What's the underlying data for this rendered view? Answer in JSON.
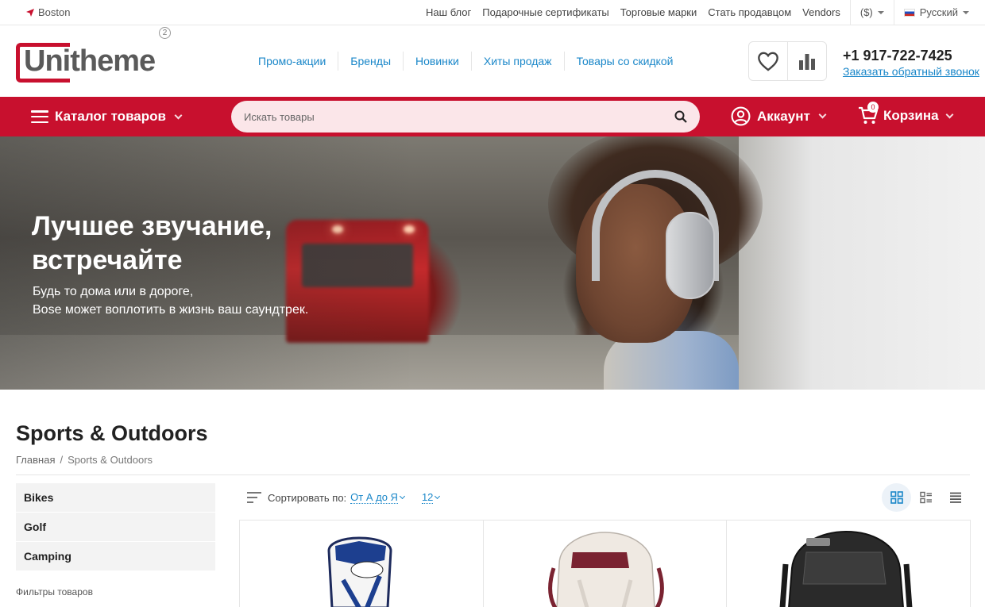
{
  "topbar": {
    "location": "Boston",
    "links": [
      "Наш блог",
      "Подарочные сертификаты",
      "Торговые марки",
      "Стать продавцом",
      "Vendors"
    ],
    "currency": "($)",
    "language": "Русский"
  },
  "header": {
    "logo_text": "Unitheme",
    "logo_badge": "2",
    "nav": [
      "Промо-акции",
      "Бренды",
      "Новинки",
      "Хиты продаж",
      "Товары со скидкой"
    ],
    "phone": "+1 917-722-7425",
    "callback": "Заказать обратный звонок"
  },
  "redbar": {
    "catalog": "Каталог товаров",
    "search_placeholder": "Искать товары",
    "account": "Аккаунт",
    "cart": "Корзина",
    "cart_count": "0"
  },
  "banner": {
    "title_line1": "Лучшее звучание,",
    "title_line2": "встречайте",
    "sub_line1": "Будь то дома или в дороге,",
    "sub_line2": "Bose может воплотить в жизнь ваш саундтрек."
  },
  "page": {
    "title": "Sports & Outdoors",
    "breadcrumb": [
      "Главная",
      "/",
      "Sports & Outdoors"
    ],
    "categories": [
      "Bikes",
      "Golf",
      "Camping"
    ],
    "filters_label": "Фильтры товаров"
  },
  "sort": {
    "label": "Сортировать по:",
    "value": "От А до Я",
    "per_page": "12"
  },
  "colors": {
    "brand_red": "#c8102e",
    "link_blue": "#1a87c9"
  }
}
